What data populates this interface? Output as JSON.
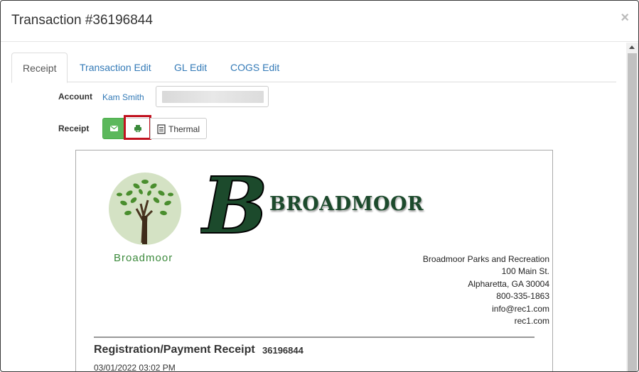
{
  "modal": {
    "title": "Transaction #36196844",
    "close_glyph": "×"
  },
  "tabs": [
    {
      "label": "Receipt",
      "active": true
    },
    {
      "label": "Transaction Edit",
      "active": false
    },
    {
      "label": "GL Edit",
      "active": false
    },
    {
      "label": "COGS Edit",
      "active": false
    }
  ],
  "form": {
    "account_label": "Account",
    "account_name": "Kam Smith",
    "receipt_label": "Receipt",
    "email_icon": "envelope-icon",
    "print_icon": "printer-icon",
    "thermal_icon": "document-icon",
    "thermal_label": "Thermal"
  },
  "receipt": {
    "tree_caption": "Broadmoor",
    "brand_name": "BROADMOOR",
    "brand_letter": "B",
    "address": [
      "Broadmoor Parks and Recreation",
      "100 Main St.",
      "Alpharetta, GA 30004",
      "800-335-1863",
      "info@rec1.com",
      "rec1.com"
    ],
    "title": "Registration/Payment Receipt",
    "number": "36196844",
    "date": "03/01/2022 03:02 PM"
  },
  "colors": {
    "link": "#337ab7",
    "success": "#5cb85c",
    "highlight": "#c1121f",
    "brand_green": "#1c4a2c"
  }
}
